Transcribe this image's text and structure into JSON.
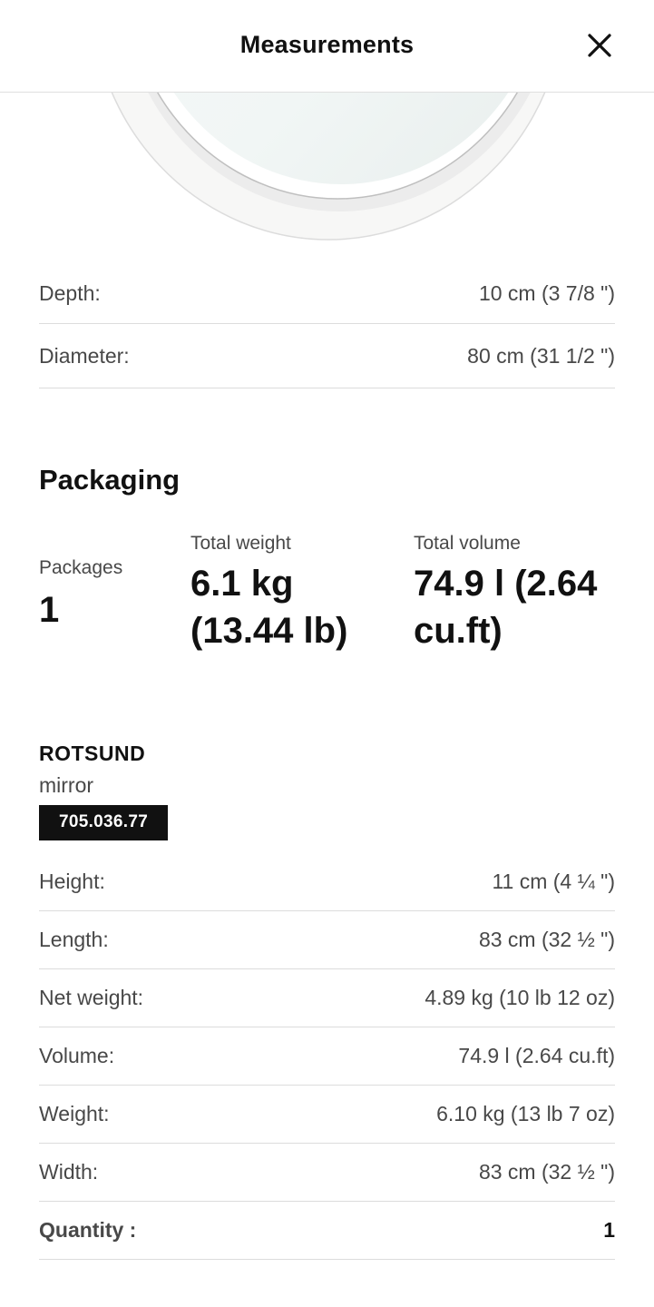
{
  "header": {
    "title": "Measurements",
    "close_icon": "close-icon"
  },
  "dimensions": [
    {
      "label": "Depth:",
      "value": "10 cm (3 7/8 \")"
    },
    {
      "label": "Diameter:",
      "value": "80 cm (31 1/2 \")"
    }
  ],
  "packaging": {
    "title": "Packaging",
    "packages_label": "Packages",
    "packages_value": "1",
    "total_weight_label": "Total weight",
    "total_weight_line1": "6.1 kg",
    "total_weight_line2": "(13.44 lb)",
    "total_volume_label": "Total volume",
    "total_volume_line1": "74.9 l (2.64",
    "total_volume_line2": "cu.ft)"
  },
  "product": {
    "name": "ROTSUND",
    "type": "mirror",
    "article_number": "705.036.77",
    "rows": [
      {
        "label": "Height:",
        "value": "11 cm (4 ¼ \")"
      },
      {
        "label": "Length:",
        "value": "83 cm (32 ½ \")"
      },
      {
        "label": "Net weight:",
        "value": "4.89 kg (10 lb 12 oz)"
      },
      {
        "label": "Volume:",
        "value": "74.9 l (2.64 cu.ft)"
      },
      {
        "label": "Weight:",
        "value": "6.10 kg (13 lb 7 oz)"
      },
      {
        "label": "Width:",
        "value": "83 cm (32 ½ \")"
      },
      {
        "label": "Quantity :",
        "value": "1"
      }
    ]
  },
  "colors": {
    "text_primary": "#111111",
    "text_secondary": "#484848",
    "divider": "#dcdcdc",
    "badge_bg": "#111111",
    "badge_text": "#ffffff"
  }
}
